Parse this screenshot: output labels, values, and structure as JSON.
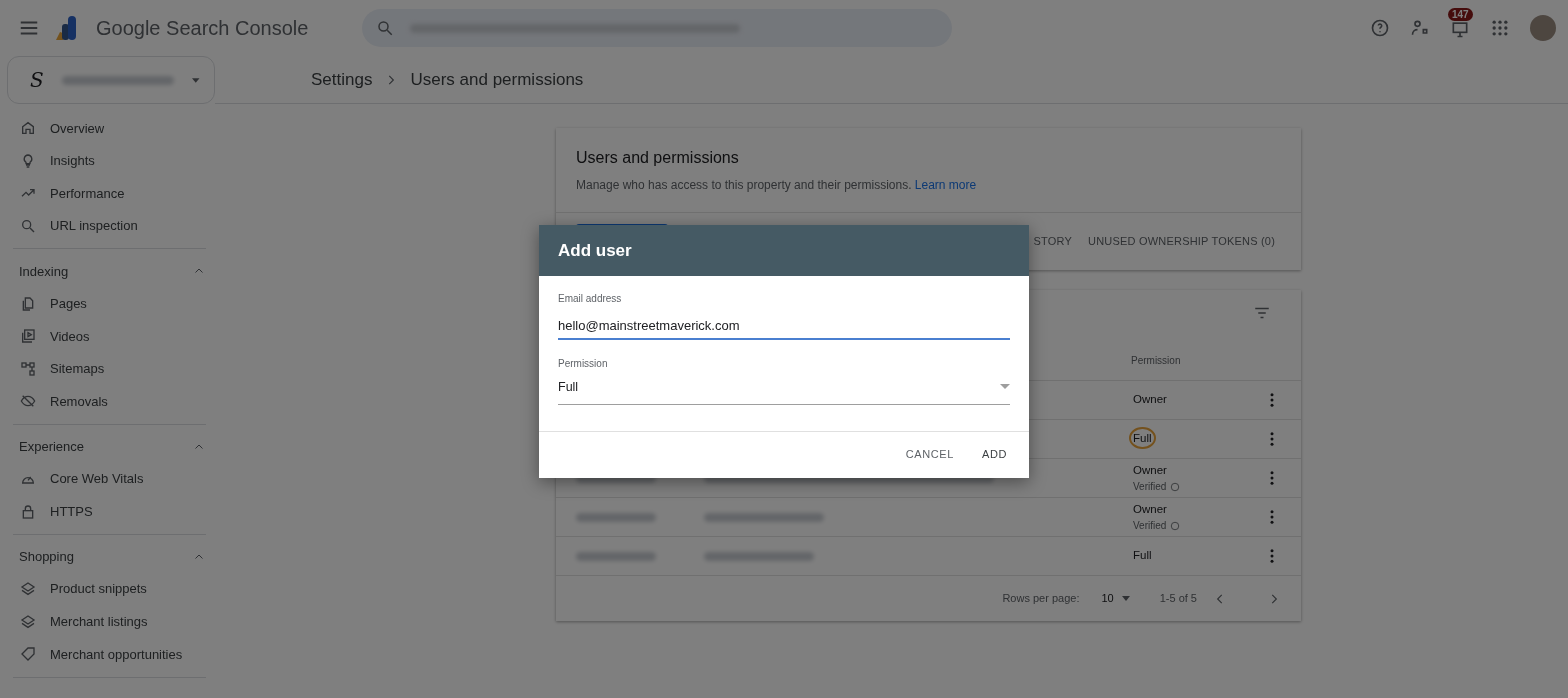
{
  "topbar": {
    "title": "Google Search Console",
    "notification_count": "147"
  },
  "property_selector": {
    "letter": "S"
  },
  "breadcrumb": [
    "Settings",
    "Users and permissions"
  ],
  "sidebar": {
    "items": [
      "Overview",
      "Insights",
      "Performance",
      "URL inspection"
    ],
    "sections": [
      {
        "title": "Indexing",
        "expanded": true,
        "items": [
          "Pages",
          "Videos",
          "Sitemaps",
          "Removals"
        ]
      },
      {
        "title": "Experience",
        "expanded": true,
        "items": [
          "Core Web Vitals",
          "HTTPS"
        ]
      },
      {
        "title": "Shopping",
        "expanded": true,
        "items": [
          "Product snippets",
          "Merchant listings",
          "Merchant opportunities"
        ]
      }
    ]
  },
  "card": {
    "title": "Users and permissions",
    "description": "Manage who has access to this property and their permissions.",
    "link": "Learn more",
    "tabs": [
      "STORY",
      "UNUSED OWNERSHIP TOKENS (0)"
    ]
  },
  "table": {
    "columns": [
      "Permission"
    ],
    "rows": [
      {
        "permission": "Owner",
        "highlighted": false
      },
      {
        "permission": "Full",
        "highlighted": true
      },
      {
        "permission": "Owner",
        "note": "Verified",
        "highlighted": false
      },
      {
        "permission": "Owner",
        "note": "Verified",
        "highlighted": false
      },
      {
        "permission": "Full",
        "highlighted": false
      }
    ],
    "footer": {
      "rows_per_page_label": "Rows per page:",
      "rows_per_page": "10",
      "range": "1-5 of 5"
    }
  },
  "dialog": {
    "title": "Add user",
    "email_label": "Email address",
    "email_value": "hello@mainstreetmaverick.com",
    "permission_label": "Permission",
    "permission_value": "Full",
    "buttons": [
      "CANCEL",
      "ADD"
    ]
  }
}
